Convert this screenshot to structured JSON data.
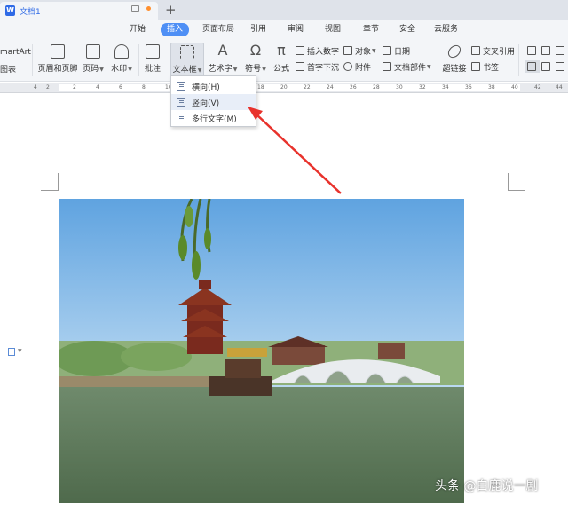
{
  "titlebar": {
    "doc_icon_letter": "W",
    "doc_name": "文档1",
    "new_tab": "+"
  },
  "menu": {
    "tabs": [
      "开始",
      "插入",
      "页面布局",
      "引用",
      "审阅",
      "视图",
      "章节",
      "安全",
      "云服务"
    ],
    "active_tab": "插入"
  },
  "ribbon": {
    "smartart_line1": "martArt",
    "smartart_line2": "图表",
    "header_footer": "页眉和页脚",
    "page_number": "页码",
    "watermark_btn": "水印",
    "comment": "批注",
    "textbox": "文本框",
    "wordart": "艺术字",
    "symbol": "符号",
    "formula": "公式",
    "insert_number": "插入数字",
    "object": "对象",
    "date": "日期",
    "drop_cap": "首字下沉",
    "attachment": "附件",
    "doc_part": "文档部件",
    "hyperlink": "超链接",
    "cross_ref": "交叉引用",
    "bookmark": "书签",
    "symbol_glyph": "Ω",
    "formula_glyph": "π",
    "wordart_glyph": "A"
  },
  "ruler": {
    "ticks": [
      "4",
      "2",
      "2",
      "4",
      "6",
      "8",
      "10",
      "12",
      "14",
      "16",
      "18",
      "20",
      "22",
      "24",
      "26",
      "28",
      "30",
      "32",
      "34",
      "36",
      "38",
      "40",
      "42",
      "44"
    ]
  },
  "dropdown": {
    "items": [
      "横向(H)",
      "竖向(V)",
      "多行文字(M)"
    ]
  },
  "watermark": "头条 @白鹿说一剧",
  "colors": {
    "accent": "#4e8ff5",
    "arrow": "#e8322c",
    "doc_blue": "#2f6ae6"
  }
}
